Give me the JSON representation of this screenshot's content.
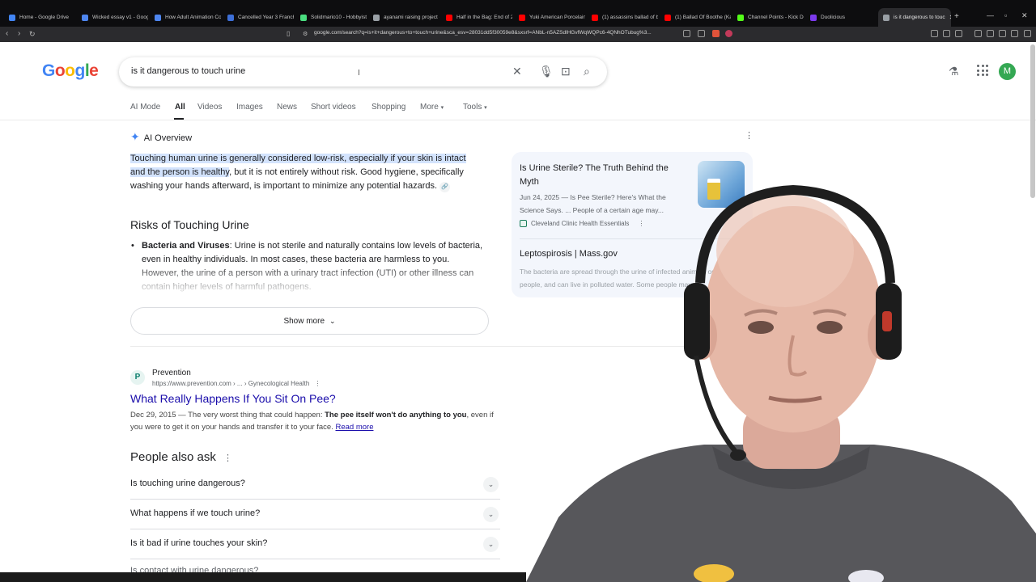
{
  "browser": {
    "tabs": [
      {
        "label": "Home - Google Drive",
        "color": "#4285f4"
      },
      {
        "label": "Wicked essay v1 - Googl",
        "color": "#4e86f0"
      },
      {
        "label": "How Adult Animation Co",
        "color": "#4e86f0"
      },
      {
        "label": "Cancelled Year 3 Franch",
        "color": "#3d6fd8"
      },
      {
        "label": "Solidmario10 - Hobbyist",
        "color": "#4ade80"
      },
      {
        "label": "ayanami raising project -",
        "color": "#9aa0a6"
      },
      {
        "label": "Half in the Bag: End of 2",
        "color": "#ff0000"
      },
      {
        "label": "Yuki American Porcelain",
        "color": "#ff0000"
      },
      {
        "label": "(1) assassins ballad of b",
        "color": "#ff0000"
      },
      {
        "label": "(1) Ballad Of Boothe (Ka",
        "color": "#ff0000"
      },
      {
        "label": "Channel Points - Kick De",
        "color": "#53fc18"
      },
      {
        "label": "Duolicious",
        "color": "#7c3aed"
      },
      {
        "label": "is it dangerous to touc",
        "color": "#9aa0a6",
        "active": true
      }
    ],
    "url": "google.com/search?q=is+it+dangerous+to+touch+urine&sca_esv=28031dd5f30059e8&sxsrf=ANbL-n5AZSdlHGvfWqWQPc6-4QNhOTubug%3..."
  },
  "search": {
    "logo": "Google",
    "query": "is it dangerous to touch urine",
    "avatar_letter": "M",
    "tabs": [
      "AI Mode",
      "All",
      "Videos",
      "Images",
      "News",
      "Short videos",
      "Shopping",
      "More",
      "Tools"
    ],
    "selected_tab": "All"
  },
  "ai_overview": {
    "label": "AI Overview",
    "highlight": "Touching human urine is generally considered low-risk, especially if your skin is intact and the person is healthy",
    "rest": ", but it is not entirely without risk. Good hygiene, specifically washing your hands afterward, is important to minimize any potential hazards.",
    "risks_heading": "Risks of Touching Urine",
    "bullet_term": "Bacteria and Viruses",
    "bullet_text": ": Urine is not sterile and naturally contains low levels of bacteria, even in healthy individuals. In most cases, these bacteria are harmless to you. However, the urine of a person with a urinary tract infection (UTI) or other illness can contain higher levels of harmful pathogens.",
    "show_more": "Show more",
    "sources": [
      {
        "title": "Is Urine Sterile? The Truth Behind the Myth",
        "meta": "Jun 24, 2025 — Is Pee Sterile? Here's What the Science Says. ... People of a certain age may...",
        "site": "Cleveland Clinic Health Essentials"
      },
      {
        "title": "Leptospirosis | Mass.gov",
        "meta": "The bacteria are spread through the urine of infected animals or people, and can live in polluted water. Some people may..."
      }
    ]
  },
  "result": {
    "favicon": "P",
    "site": "Prevention",
    "url": "https://www.prevention.com › ... › Gynecological Health",
    "title": "What Really Happens If You Sit On Pee?",
    "snippet_pre": "Dec 29, 2015 — The very worst thing that could happen: ",
    "snippet_bold": "The pee itself won't do anything to you",
    "snippet_post": ", even if you were to get it on your hands and transfer it to your face.",
    "read_more": "Read more"
  },
  "paa": {
    "heading": "People also ask",
    "questions": [
      "Is touching urine dangerous?",
      "What happens if we touch urine?",
      "Is it bad if urine touches your skin?"
    ],
    "partial": "Is contact with urine dangerous?"
  }
}
